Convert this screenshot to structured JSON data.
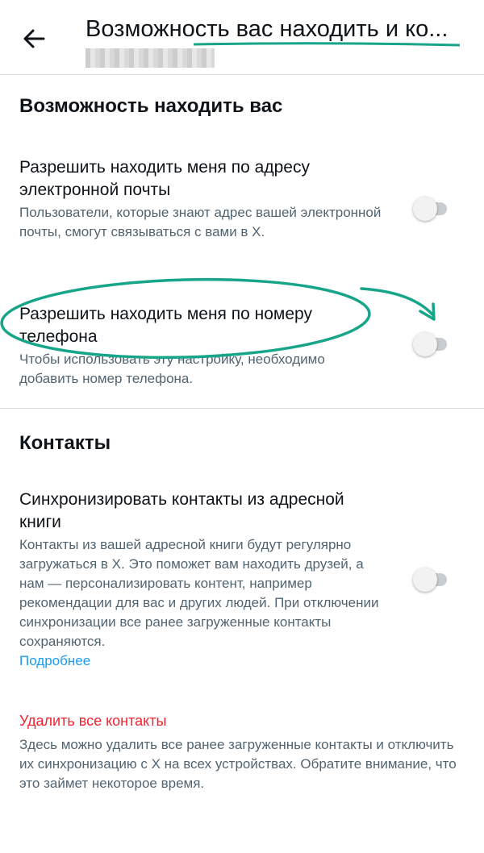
{
  "header": {
    "title": "Возможность вас находить и ко...",
    "back_icon": "back-arrow-icon"
  },
  "discoverability": {
    "heading": "Возможность находить вас",
    "email": {
      "title": "Разрешить находить меня по адресу электронной почты",
      "description": "Пользователи, которые знают адрес вашей электронной почты, смогут связываться с вами в X.",
      "enabled": false
    },
    "phone": {
      "title": "Разрешить находить меня по номеру телефона",
      "description": "Чтобы использовать эту настройку, необходимо добавить номер телефона.",
      "enabled": false
    }
  },
  "contacts": {
    "heading": "Контакты",
    "sync": {
      "title": "Синхронизировать контакты из адресной книги",
      "description": "Контакты из вашей адресной книги будут регулярно загружаться в X. Это поможет вам находить друзей, а нам — персонализировать контент, например рекомендации для вас и других людей. При отключении синхронизации все ранее загруженные контакты сохраняются.",
      "enabled": false,
      "learn_more": "Подробнее"
    },
    "delete": {
      "label": "Удалить все контакты",
      "description": "Здесь можно удалить все ранее загруженные контакты и отключить их синхронизацию с X на всех устройствах. Обратите внимание, что это займет некоторое время."
    }
  },
  "colors": {
    "accent": "#1d9bf0",
    "danger": "#f4212e",
    "annotation": "#17a589"
  }
}
